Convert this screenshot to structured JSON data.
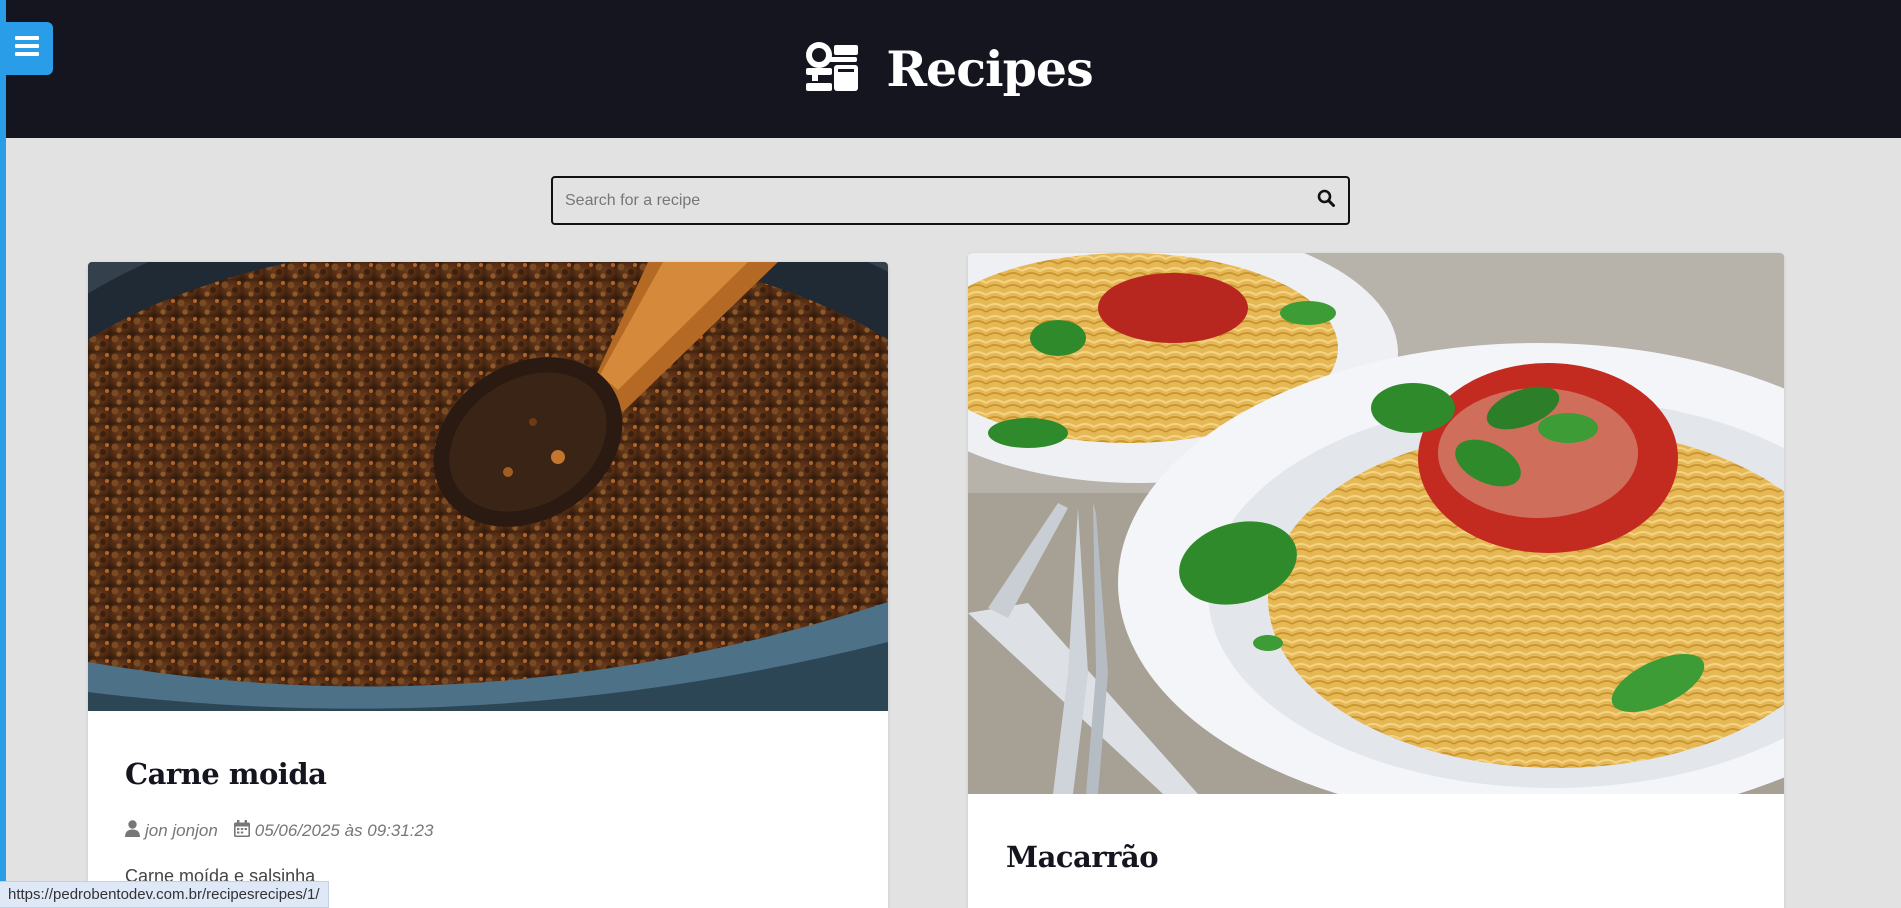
{
  "header": {
    "title": "Recipes",
    "logo_icon": "kitchen-scale-icon",
    "background": "#14151f"
  },
  "menu": {
    "icon": "hamburger-menu-icon",
    "accent": "#2a9de8"
  },
  "search": {
    "placeholder": "Search for a recipe",
    "value": "",
    "icon": "search-icon"
  },
  "recipes": [
    {
      "title": "Carne moida",
      "author": "jon jonjon",
      "date": "05/06/2025 às 09:31:23",
      "description": "Carne moída e salsinha",
      "image": "ground-beef-pan-photo"
    },
    {
      "title": "Macarrão",
      "image": "spaghetti-plate-photo"
    }
  ],
  "status_bar": {
    "url": "https://pedrobentodev.com.br/recipesrecipes/1/"
  }
}
